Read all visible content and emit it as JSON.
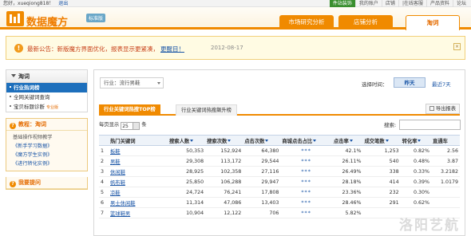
{
  "topbar": {
    "user_text": "您好，xueqiong818！",
    "logout": "退出",
    "links": [
      "件站装饰",
      "我的账户",
      "店铺",
      "|在线客服",
      "产品资料",
      "论坛"
    ]
  },
  "header": {
    "logo_text": "数据魔方",
    "edition": "标准版",
    "nav": [
      {
        "label": "市场研究分析"
      },
      {
        "label": "店铺分析"
      },
      {
        "label": "淘词"
      }
    ]
  },
  "notice": {
    "icon": "!",
    "prefix": "最新公告：",
    "message": "新版魔方界面优化，报表显示更紧凑，",
    "link": "更醒目！",
    "date": "2012-08-17",
    "close": "×"
  },
  "sidebar": {
    "title": "淘词",
    "items": [
      {
        "label": "行业热词榜",
        "badge": ""
      },
      {
        "label": "全网关键词查询",
        "badge": ""
      },
      {
        "label": "宝贝标题诊断",
        "badge": "专业版"
      }
    ],
    "help_title": "教程：淘词",
    "help_icon": "?",
    "help_items": [
      "基础操作视频教学",
      "《新手学习数据》",
      "《魔方学生实例》",
      "《进行转化实例》"
    ],
    "feedback_title": "我要提问",
    "feedback_icon": "?"
  },
  "main": {
    "category": "行业：流行男鞋",
    "time_label": "选择时间：",
    "time_yesterday": "昨天",
    "time_7days": "最近7天",
    "tab_active": "行业关键词热搜TOP榜",
    "tab_inactive": "行业关键词热搜飙升榜",
    "export": "导出报表",
    "perpage_prefix": "每页显示",
    "perpage_value": "25",
    "perpage_suffix": "条",
    "search_label": "搜索:",
    "columns": [
      "",
      "热门关键词",
      "搜索人数",
      "搜索次数",
      "点击次数",
      "商城点击占比",
      "点击率",
      "成交笔数",
      "转化率",
      "直通车"
    ],
    "rows": [
      [
        "1",
        "板鞋",
        "50,353",
        "152,924",
        "64,380",
        "***",
        "42.1%",
        "1,253",
        "0.82%",
        "2.56"
      ],
      [
        "2",
        "男鞋",
        "29,308",
        "113,172",
        "29,544",
        "***",
        "26.11%",
        "540",
        "0.48%",
        "3.87"
      ],
      [
        "3",
        "休闲鞋",
        "28,925",
        "102,358",
        "27,116",
        "***",
        "26.49%",
        "338",
        "0.33%",
        "3.2182"
      ],
      [
        "4",
        "帆布鞋",
        "25,850",
        "106,288",
        "29,947",
        "***",
        "28.18%",
        "414",
        "0.39%",
        "1.0179"
      ],
      [
        "5",
        "凉鞋",
        "24,724",
        "76,241",
        "17,808",
        "***",
        "23.36%",
        "232",
        "0.30%",
        ""
      ],
      [
        "6",
        "男士休闲鞋",
        "11,314",
        "47,086",
        "13,403",
        "***",
        "28.46%",
        "291",
        "0.62%",
        ""
      ],
      [
        "7",
        "篮球鞋男",
        "10,904",
        "12,122",
        "706",
        "***",
        "5.82%",
        "",
        "",
        ""
      ]
    ]
  },
  "watermark": "洛阳艺航",
  "colors": {
    "brand_orange": "#f08a00",
    "link_blue": "#1a55a6",
    "sidebar_active": "#1d6fbc"
  }
}
